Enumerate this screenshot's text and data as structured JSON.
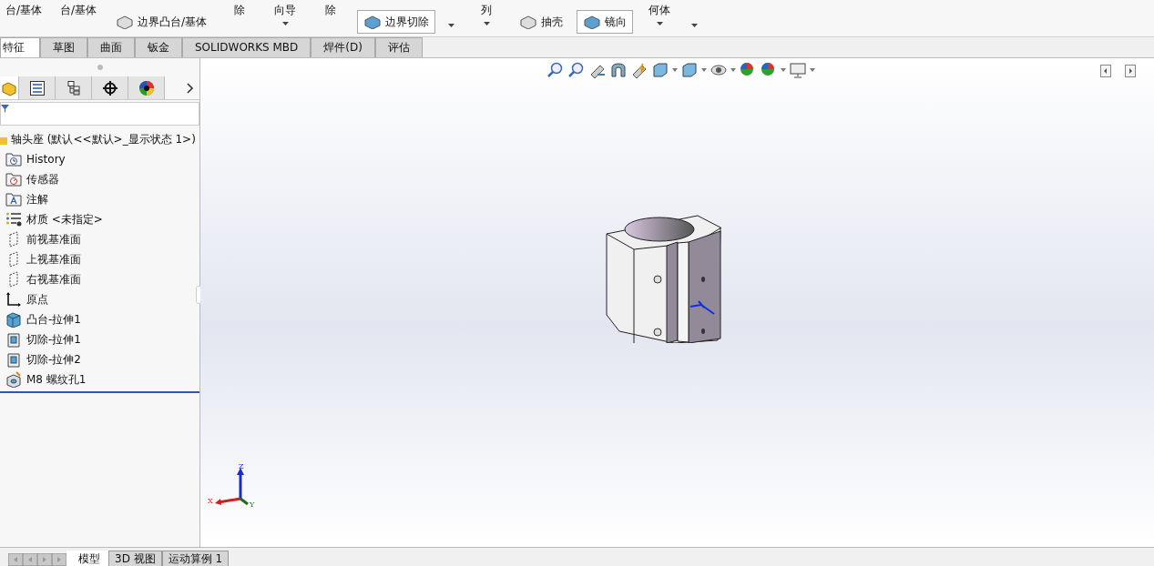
{
  "command_manager": {
    "groups": [
      {
        "kind": "big",
        "label": "台/基体"
      },
      {
        "kind": "big",
        "label": "台/基体"
      },
      {
        "kind": "small",
        "label": "边界凸台/基体",
        "framed": false
      },
      {
        "kind": "big",
        "label": "除"
      },
      {
        "kind": "bigarrow",
        "label": "向导"
      },
      {
        "kind": "big",
        "label": "除"
      },
      {
        "kind": "small",
        "label": "边界切除",
        "framed": true
      },
      {
        "kind": "arrow"
      },
      {
        "kind": "bigarrow",
        "label": "列"
      },
      {
        "kind": "small",
        "label": "抽壳",
        "framed": false
      },
      {
        "kind": "small",
        "label": "镜向",
        "framed": true
      },
      {
        "kind": "bigarrow",
        "label": "何体"
      },
      {
        "kind": "arrow"
      }
    ]
  },
  "tabs": [
    {
      "label": "特征",
      "selected": true
    },
    {
      "label": "草图",
      "selected": false
    },
    {
      "label": "曲面",
      "selected": false
    },
    {
      "label": "钣金",
      "selected": false
    },
    {
      "label": "SOLIDWORKS MBD",
      "selected": false
    },
    {
      "label": "焊件(D)",
      "selected": false
    },
    {
      "label": "评估",
      "selected": false
    }
  ],
  "manager_tabs": [
    {
      "kind": "feature",
      "selected": true
    },
    {
      "kind": "property",
      "selected": false
    },
    {
      "kind": "config",
      "selected": false
    },
    {
      "kind": "dim",
      "selected": false
    },
    {
      "kind": "display",
      "selected": false
    }
  ],
  "tree": {
    "root": "轴头座  (默认<<默认>_显示状态 1>)",
    "items": [
      {
        "kind": "history",
        "label": "History"
      },
      {
        "kind": "sensor",
        "label": "传感器"
      },
      {
        "kind": "annotation",
        "label": "注解"
      },
      {
        "kind": "material",
        "label": "材质 <未指定>"
      },
      {
        "kind": "plane",
        "label": "前视基准面"
      },
      {
        "kind": "plane",
        "label": "上视基准面"
      },
      {
        "kind": "plane",
        "label": "右视基准面"
      },
      {
        "kind": "origin",
        "label": "原点"
      },
      {
        "kind": "boss",
        "label": "凸台-拉伸1"
      },
      {
        "kind": "cut",
        "label": "切除-拉伸1"
      },
      {
        "kind": "cut",
        "label": "切除-拉伸2"
      },
      {
        "kind": "hole",
        "label": "M8 螺纹孔1"
      }
    ]
  },
  "triad": {
    "x": "X",
    "y": "Y",
    "z": "Z"
  },
  "bottom_tabs": [
    {
      "label": "模型",
      "selected": true
    },
    {
      "label": "3D 视图",
      "selected": false
    },
    {
      "label": "运动算例 1",
      "selected": false
    }
  ]
}
